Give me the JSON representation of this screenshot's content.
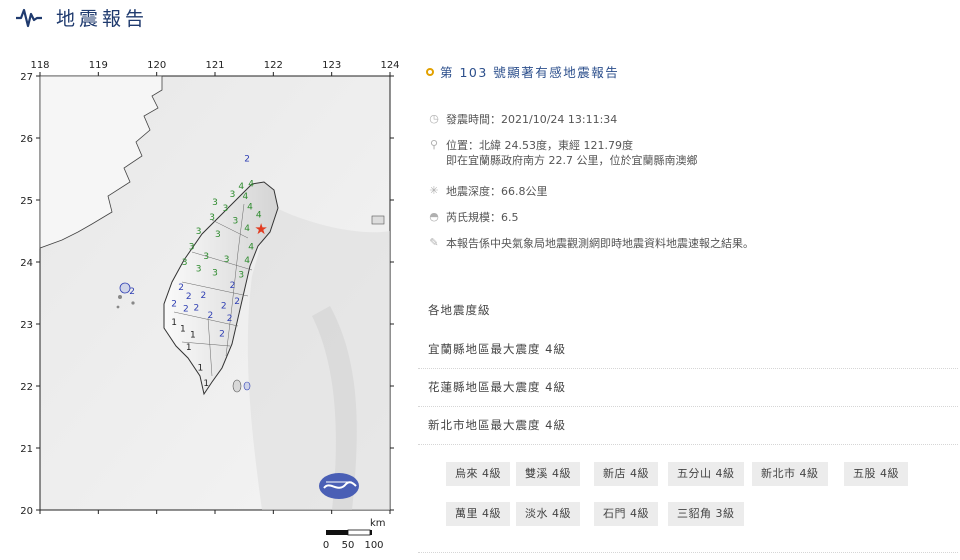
{
  "header": {
    "title": "地震報告",
    "icon": "seismograph-icon",
    "accent": "#1f3a6e"
  },
  "map": {
    "x_ticks": [
      "118",
      "119",
      "120",
      "121",
      "122",
      "123",
      "124"
    ],
    "y_ticks": [
      "27",
      "26",
      "25",
      "24",
      "23",
      "22",
      "21",
      "20"
    ],
    "scale_unit": "km",
    "scale_labels": [
      "0",
      "50",
      "100"
    ],
    "epicenter_marker": "★",
    "intensity_colors": {
      "1": "#222222",
      "2": "#2f3fb3",
      "3": "#2e8b2e",
      "4": "#2e8b2e"
    },
    "intensity_labels": [
      {
        "v": "2",
        "lon": 121.55,
        "lat": 25.62
      },
      {
        "v": "2",
        "lon": 119.58,
        "lat": 23.48
      },
      {
        "v": "4",
        "lon": 121.62,
        "lat": 25.22
      },
      {
        "v": "4",
        "lon": 121.45,
        "lat": 25.18
      },
      {
        "v": "3",
        "lon": 121.3,
        "lat": 25.05
      },
      {
        "v": "4",
        "lon": 121.52,
        "lat": 25.02
      },
      {
        "v": "3",
        "lon": 121.0,
        "lat": 24.92
      },
      {
        "v": "3",
        "lon": 121.18,
        "lat": 24.82
      },
      {
        "v": "4",
        "lon": 121.6,
        "lat": 24.85
      },
      {
        "v": "4",
        "lon": 121.75,
        "lat": 24.72
      },
      {
        "v": "3",
        "lon": 120.95,
        "lat": 24.68
      },
      {
        "v": "3",
        "lon": 121.35,
        "lat": 24.62
      },
      {
        "v": "4",
        "lon": 121.55,
        "lat": 24.5
      },
      {
        "v": "3",
        "lon": 120.72,
        "lat": 24.45
      },
      {
        "v": "3",
        "lon": 121.05,
        "lat": 24.4
      },
      {
        "v": "4",
        "lon": 121.62,
        "lat": 24.2
      },
      {
        "v": "3",
        "lon": 120.6,
        "lat": 24.2
      },
      {
        "v": "3",
        "lon": 120.85,
        "lat": 24.05
      },
      {
        "v": "3",
        "lon": 121.2,
        "lat": 24.0
      },
      {
        "v": "4",
        "lon": 121.55,
        "lat": 23.98
      },
      {
        "v": "3",
        "lon": 120.48,
        "lat": 23.95
      },
      {
        "v": "3",
        "lon": 120.72,
        "lat": 23.85
      },
      {
        "v": "3",
        "lon": 121.0,
        "lat": 23.78
      },
      {
        "v": "3",
        "lon": 121.45,
        "lat": 23.75
      },
      {
        "v": "2",
        "lon": 121.3,
        "lat": 23.58
      },
      {
        "v": "2",
        "lon": 120.42,
        "lat": 23.55
      },
      {
        "v": "2",
        "lon": 120.55,
        "lat": 23.4
      },
      {
        "v": "2",
        "lon": 120.8,
        "lat": 23.42
      },
      {
        "v": "2",
        "lon": 121.38,
        "lat": 23.32
      },
      {
        "v": "2",
        "lon": 120.3,
        "lat": 23.28
      },
      {
        "v": "2",
        "lon": 120.5,
        "lat": 23.2
      },
      {
        "v": "2",
        "lon": 120.68,
        "lat": 23.22
      },
      {
        "v": "2",
        "lon": 121.15,
        "lat": 23.25
      },
      {
        "v": "2",
        "lon": 120.92,
        "lat": 23.1
      },
      {
        "v": "2",
        "lon": 121.25,
        "lat": 23.05
      },
      {
        "v": "1",
        "lon": 120.3,
        "lat": 22.98
      },
      {
        "v": "1",
        "lon": 120.45,
        "lat": 22.88
      },
      {
        "v": "1",
        "lon": 120.62,
        "lat": 22.78
      },
      {
        "v": "2",
        "lon": 121.12,
        "lat": 22.8
      },
      {
        "v": "1",
        "lon": 120.55,
        "lat": 22.58
      },
      {
        "v": "1",
        "lon": 120.75,
        "lat": 22.25
      },
      {
        "v": "1",
        "lon": 120.85,
        "lat": 22.0
      }
    ]
  },
  "report": {
    "title": "第 103 號顯著有感地震報告",
    "issue_time": "發震時間：2021/10/24 13:11:34",
    "location_line1": "位置：北緯 24.53度，東經 121.79度",
    "location_line2": "即在宜蘭縣政府南方 22.7 公里，位於宜蘭縣南澳鄉",
    "depth": "地震深度：66.8公里",
    "magnitude": "芮氏規模：6.5",
    "note": "本報告係中央氣象局地震觀測網即時地震資料地震速報之結果。"
  },
  "intensity_section": {
    "title": "各地震度級",
    "county_max": [
      "宜蘭縣地區最大震度 4級",
      "花蓮縣地區最大震度 4級",
      "新北市地區最大震度 4級"
    ],
    "stations": [
      "烏來 4級",
      "雙溪 4級",
      "新店 4級",
      "五分山 4級",
      "新北市 4級",
      "五股 4級",
      "萬里 4級",
      "淡水 4級",
      "石門 4級",
      "三貂角 3級"
    ]
  }
}
